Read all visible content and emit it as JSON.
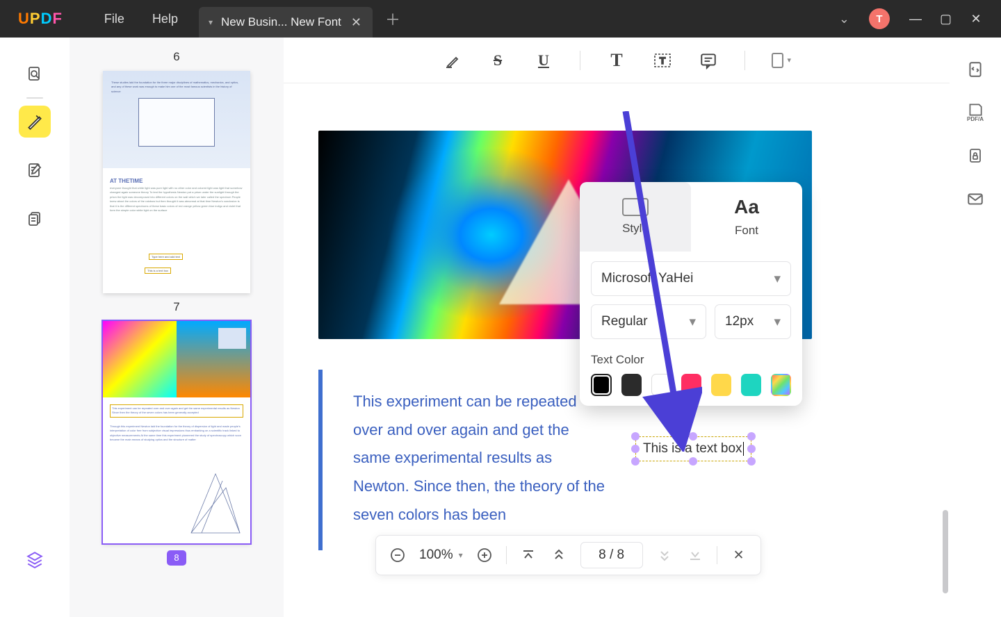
{
  "app": {
    "logo": "UPDF",
    "avatar_initial": "T"
  },
  "menu": {
    "file": "File",
    "help": "Help"
  },
  "tab": {
    "title": "New Busin... New Font"
  },
  "thumbnails": {
    "page6_num": "6",
    "page7_num": "7",
    "page8_badge": "8",
    "th6_title": "AT THETIME"
  },
  "document": {
    "paragraph": "This experiment can be repeated over and over again and get the same experimental results as Newton. Since then, the theory of the seven colors has been",
    "textbox_value": "This is a text box"
  },
  "font_panel": {
    "tab_style": "Style",
    "tab_font": "Font",
    "font_family": "Microsoft YaHei",
    "font_weight": "Regular",
    "font_size": "12px",
    "color_label": "Text Color",
    "swatches": [
      "#000000",
      "#2b2b2b",
      "#ffffff",
      "#ff2e63",
      "#ffd84a",
      "#1ed5c0",
      "gradient"
    ]
  },
  "pagenav": {
    "zoom": "100%",
    "page_display": "8 / 8"
  },
  "right_rail": {
    "pdfa": "PDF/A"
  }
}
